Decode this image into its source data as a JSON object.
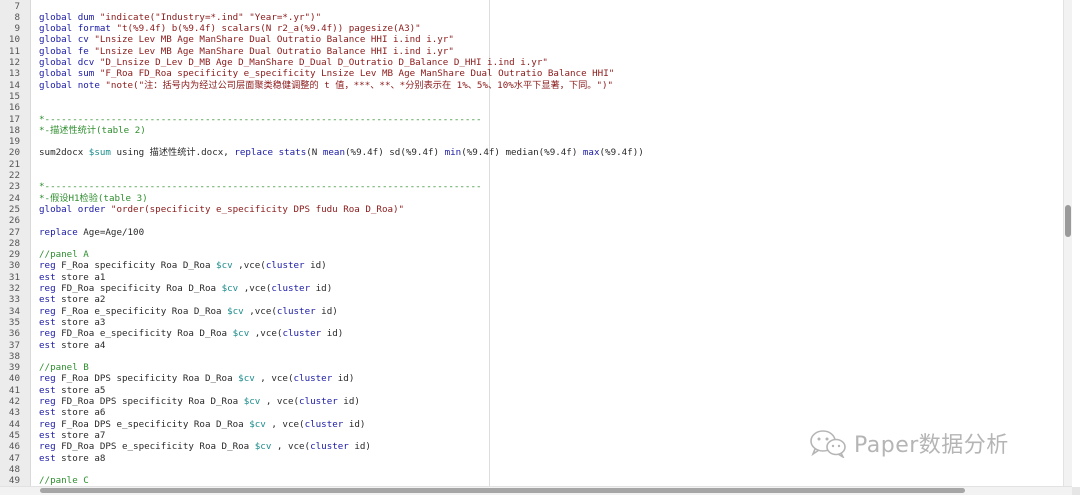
{
  "lines": [
    {
      "no": "7",
      "segs": []
    },
    {
      "no": "8",
      "segs": [
        {
          "t": "global dum ",
          "c": "kw"
        },
        {
          "t": "\"indicate(\"Industry=*.ind\" \"Year=*.yr\")\"",
          "c": "str"
        }
      ]
    },
    {
      "no": "9",
      "segs": [
        {
          "t": "global format ",
          "c": "kw"
        },
        {
          "t": "\"t(%9.4f) b(%9.4f) scalars(N r2_a(%9.4f)) pagesize(A3)\"",
          "c": "str"
        }
      ]
    },
    {
      "no": "10",
      "segs": [
        {
          "t": "global cv ",
          "c": "kw"
        },
        {
          "t": "\"Lnsize Lev MB Age ManShare Dual Outratio Balance HHI i.ind i.yr\"",
          "c": "str"
        }
      ]
    },
    {
      "no": "11",
      "segs": [
        {
          "t": "global fe ",
          "c": "kw"
        },
        {
          "t": "\"Lnsize Lev MB Age ManShare Dual Outratio Balance HHI i.ind i.yr\"",
          "c": "str"
        }
      ]
    },
    {
      "no": "12",
      "segs": [
        {
          "t": "global dcv ",
          "c": "kw"
        },
        {
          "t": "\"D_Lnsize D_Lev D_MB Age D_ManShare D_Dual D_Outratio D_Balance D_HHI i.ind i.yr\"",
          "c": "str"
        }
      ]
    },
    {
      "no": "13",
      "segs": [
        {
          "t": "global sum ",
          "c": "kw"
        },
        {
          "t": "\"F_Roa FD_Roa specificity e_specificity Lnsize Lev MB Age ManShare Dual Outratio Balance HHI\"",
          "c": "str"
        }
      ]
    },
    {
      "no": "14",
      "segs": [
        {
          "t": "global note ",
          "c": "kw"
        },
        {
          "t": "\"note(\"注：括号内为经过公司层面聚类稳健调整的 t 值，***、**、*分别表示在 1%、5%、10%水平下显著，下同。\")\"",
          "c": "str"
        }
      ]
    },
    {
      "no": "15",
      "segs": []
    },
    {
      "no": "16",
      "segs": []
    },
    {
      "no": "17",
      "segs": [
        {
          "t": "*-------------------------------------------------------------------------------",
          "c": "cmt"
        }
      ]
    },
    {
      "no": "18",
      "segs": [
        {
          "t": "*-描述性统计(table 2)",
          "c": "cmt"
        }
      ]
    },
    {
      "no": "19",
      "segs": []
    },
    {
      "no": "20",
      "segs": [
        {
          "t": "sum2docx ",
          "c": ""
        },
        {
          "t": "$sum",
          "c": "mac"
        },
        {
          "t": " using 描述性统计.docx, ",
          "c": ""
        },
        {
          "t": "replace stats",
          "c": "kw"
        },
        {
          "t": "(N ",
          "c": ""
        },
        {
          "t": "mean",
          "c": "kw"
        },
        {
          "t": "(%9.4f) sd(%9.4f) ",
          "c": ""
        },
        {
          "t": "min",
          "c": "kw"
        },
        {
          "t": "(%9.4f) median(%9.4f) ",
          "c": ""
        },
        {
          "t": "max",
          "c": "kw"
        },
        {
          "t": "(%9.4f))",
          "c": ""
        }
      ]
    },
    {
      "no": "21",
      "segs": []
    },
    {
      "no": "22",
      "segs": []
    },
    {
      "no": "23",
      "segs": [
        {
          "t": "*-------------------------------------------------------------------------------",
          "c": "cmt"
        }
      ]
    },
    {
      "no": "24",
      "segs": [
        {
          "t": "*-假设H1检验(table 3)",
          "c": "cmt"
        }
      ]
    },
    {
      "no": "25",
      "segs": [
        {
          "t": "global order ",
          "c": "kw"
        },
        {
          "t": "\"order(specificity e_specificity DPS fudu Roa D_Roa)\"",
          "c": "str"
        }
      ]
    },
    {
      "no": "26",
      "segs": []
    },
    {
      "no": "27",
      "segs": [
        {
          "t": "replace",
          "c": "kw"
        },
        {
          "t": " Age=Age/100",
          "c": ""
        }
      ]
    },
    {
      "no": "28",
      "segs": []
    },
    {
      "no": "29",
      "segs": [
        {
          "t": "//panel A",
          "c": "cmt"
        }
      ]
    },
    {
      "no": "30",
      "segs": [
        {
          "t": "reg",
          "c": "kw"
        },
        {
          "t": " F_Roa specificity Roa D_Roa ",
          "c": ""
        },
        {
          "t": "$cv",
          "c": "mac"
        },
        {
          "t": " ,vce(",
          "c": ""
        },
        {
          "t": "cluster",
          "c": "kw"
        },
        {
          "t": " id)",
          "c": ""
        }
      ]
    },
    {
      "no": "31",
      "segs": [
        {
          "t": "est",
          "c": "kw"
        },
        {
          "t": " store a1",
          "c": ""
        }
      ]
    },
    {
      "no": "32",
      "segs": [
        {
          "t": "reg",
          "c": "kw"
        },
        {
          "t": " FD_Roa specificity Roa D_Roa ",
          "c": ""
        },
        {
          "t": "$cv",
          "c": "mac"
        },
        {
          "t": " ,vce(",
          "c": ""
        },
        {
          "t": "cluster",
          "c": "kw"
        },
        {
          "t": " id)",
          "c": ""
        }
      ]
    },
    {
      "no": "33",
      "segs": [
        {
          "t": "est",
          "c": "kw"
        },
        {
          "t": " store a2",
          "c": ""
        }
      ]
    },
    {
      "no": "34",
      "segs": [
        {
          "t": "reg",
          "c": "kw"
        },
        {
          "t": " F_Roa e_specificity Roa D_Roa ",
          "c": ""
        },
        {
          "t": "$cv",
          "c": "mac"
        },
        {
          "t": " ,vce(",
          "c": ""
        },
        {
          "t": "cluster",
          "c": "kw"
        },
        {
          "t": " id)",
          "c": ""
        }
      ]
    },
    {
      "no": "35",
      "segs": [
        {
          "t": "est",
          "c": "kw"
        },
        {
          "t": " store a3",
          "c": ""
        }
      ]
    },
    {
      "no": "36",
      "segs": [
        {
          "t": "reg",
          "c": "kw"
        },
        {
          "t": " FD_Roa e_specificity Roa D_Roa ",
          "c": ""
        },
        {
          "t": "$cv",
          "c": "mac"
        },
        {
          "t": " ,vce(",
          "c": ""
        },
        {
          "t": "cluster",
          "c": "kw"
        },
        {
          "t": " id)",
          "c": ""
        }
      ]
    },
    {
      "no": "37",
      "segs": [
        {
          "t": "est",
          "c": "kw"
        },
        {
          "t": " store a4",
          "c": ""
        }
      ]
    },
    {
      "no": "38",
      "segs": []
    },
    {
      "no": "39",
      "segs": [
        {
          "t": "//panel B",
          "c": "cmt"
        }
      ]
    },
    {
      "no": "40",
      "segs": [
        {
          "t": "reg",
          "c": "kw"
        },
        {
          "t": " F_Roa DPS specificity Roa D_Roa ",
          "c": ""
        },
        {
          "t": "$cv",
          "c": "mac"
        },
        {
          "t": " , vce(",
          "c": ""
        },
        {
          "t": "cluster",
          "c": "kw"
        },
        {
          "t": " id)",
          "c": ""
        }
      ]
    },
    {
      "no": "41",
      "segs": [
        {
          "t": "est",
          "c": "kw"
        },
        {
          "t": " store a5",
          "c": ""
        }
      ]
    },
    {
      "no": "42",
      "segs": [
        {
          "t": "reg",
          "c": "kw"
        },
        {
          "t": " FD_Roa DPS specificity Roa D_Roa ",
          "c": ""
        },
        {
          "t": "$cv",
          "c": "mac"
        },
        {
          "t": " , vce(",
          "c": ""
        },
        {
          "t": "cluster",
          "c": "kw"
        },
        {
          "t": " id)",
          "c": ""
        }
      ]
    },
    {
      "no": "43",
      "segs": [
        {
          "t": "est",
          "c": "kw"
        },
        {
          "t": " store a6",
          "c": ""
        }
      ]
    },
    {
      "no": "44",
      "segs": [
        {
          "t": "reg",
          "c": "kw"
        },
        {
          "t": " F_Roa DPS e_specificity Roa D_Roa ",
          "c": ""
        },
        {
          "t": "$cv",
          "c": "mac"
        },
        {
          "t": " , vce(",
          "c": ""
        },
        {
          "t": "cluster",
          "c": "kw"
        },
        {
          "t": " id)",
          "c": ""
        }
      ]
    },
    {
      "no": "45",
      "segs": [
        {
          "t": "est",
          "c": "kw"
        },
        {
          "t": " store a7",
          "c": ""
        }
      ]
    },
    {
      "no": "46",
      "segs": [
        {
          "t": "reg",
          "c": "kw"
        },
        {
          "t": " FD_Roa DPS e_specificity Roa D_Roa ",
          "c": ""
        },
        {
          "t": "$cv",
          "c": "mac"
        },
        {
          "t": " , vce(",
          "c": ""
        },
        {
          "t": "cluster",
          "c": "kw"
        },
        {
          "t": " id)",
          "c": ""
        }
      ]
    },
    {
      "no": "47",
      "segs": [
        {
          "t": "est",
          "c": "kw"
        },
        {
          "t": " store a8",
          "c": ""
        }
      ]
    },
    {
      "no": "48",
      "segs": []
    },
    {
      "no": "49",
      "segs": [
        {
          "t": "//panle C",
          "c": "cmt"
        }
      ]
    }
  ],
  "watermark": {
    "text": "Paper数据分析",
    "icon": "wechat-icon"
  },
  "colors": {
    "keyword": "#1a1aa6",
    "string": "#8b1a1a",
    "comment": "#2f8f2f",
    "macro": "#1c8c8c"
  }
}
